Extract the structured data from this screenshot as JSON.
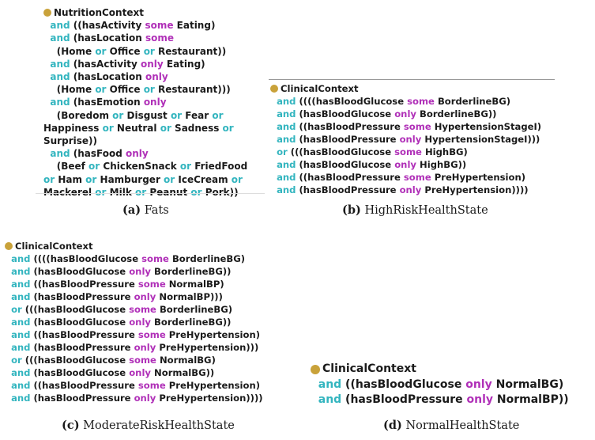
{
  "colors": {
    "keyword_connective": "#33b5bf",
    "keyword_quantifier": "#b030b8",
    "text": "#1a1a1a",
    "class_dot": "#c9a23a"
  },
  "panels": [
    {
      "id": "a",
      "class_name": "NutritionContext",
      "lines": [
        [
          {
            "t": "  "
          },
          {
            "k": "and",
            "c": "kw-and"
          },
          {
            "t": " ((hasActivity "
          },
          {
            "k": "some",
            "c": "kw-some"
          },
          {
            "t": " Eating)"
          }
        ],
        [
          {
            "t": "  "
          },
          {
            "k": "and",
            "c": "kw-and"
          },
          {
            "t": " (hasLocation "
          },
          {
            "k": "some",
            "c": "kw-some"
          }
        ],
        [
          {
            "t": "    (Home "
          },
          {
            "k": "or",
            "c": "kw-or"
          },
          {
            "t": " Office "
          },
          {
            "k": "or",
            "c": "kw-or"
          },
          {
            "t": " Restaurant))"
          }
        ],
        [
          {
            "t": "  "
          },
          {
            "k": "and",
            "c": "kw-and"
          },
          {
            "t": " (hasActivity "
          },
          {
            "k": "only",
            "c": "kw-only"
          },
          {
            "t": " Eating)"
          }
        ],
        [
          {
            "t": "  "
          },
          {
            "k": "and",
            "c": "kw-and"
          },
          {
            "t": " (hasLocation "
          },
          {
            "k": "only",
            "c": "kw-only"
          }
        ],
        [
          {
            "t": "    (Home "
          },
          {
            "k": "or",
            "c": "kw-or"
          },
          {
            "t": " Office "
          },
          {
            "k": "or",
            "c": "kw-or"
          },
          {
            "t": " Restaurant)))"
          }
        ],
        [
          {
            "t": "  "
          },
          {
            "k": "and",
            "c": "kw-and"
          },
          {
            "t": " (hasEmotion "
          },
          {
            "k": "only",
            "c": "kw-only"
          }
        ],
        [
          {
            "t": "    (Boredom "
          },
          {
            "k": "or",
            "c": "kw-or"
          },
          {
            "t": " Disgust "
          },
          {
            "k": "or",
            "c": "kw-or"
          },
          {
            "t": " Fear "
          },
          {
            "k": "or",
            "c": "kw-or"
          }
        ],
        [
          {
            "t": "Happiness "
          },
          {
            "k": "or",
            "c": "kw-or"
          },
          {
            "t": " Neutral "
          },
          {
            "k": "or",
            "c": "kw-or"
          },
          {
            "t": " Sadness "
          },
          {
            "k": "or",
            "c": "kw-or"
          }
        ],
        [
          {
            "t": "Surprise))"
          }
        ],
        [
          {
            "t": "  "
          },
          {
            "k": "and",
            "c": "kw-and"
          },
          {
            "t": " (hasFood "
          },
          {
            "k": "only",
            "c": "kw-only"
          }
        ],
        [
          {
            "t": "    (Beef "
          },
          {
            "k": "or",
            "c": "kw-or"
          },
          {
            "t": " ChickenSnack "
          },
          {
            "k": "or",
            "c": "kw-or"
          },
          {
            "t": " FriedFood"
          }
        ],
        [
          {
            "k": "or",
            "c": "kw-or"
          },
          {
            "t": " Ham "
          },
          {
            "k": "or",
            "c": "kw-or"
          },
          {
            "t": " Hamburger "
          },
          {
            "k": "or",
            "c": "kw-or"
          },
          {
            "t": " IceCream "
          },
          {
            "k": "or",
            "c": "kw-or"
          }
        ],
        [
          {
            "t": "Mackerel "
          },
          {
            "k": "or",
            "c": "kw-or"
          },
          {
            "t": " Milk "
          },
          {
            "k": "or",
            "c": "kw-or"
          },
          {
            "t": " Peanut "
          },
          {
            "k": "or",
            "c": "kw-or"
          },
          {
            "t": " Pork))"
          }
        ]
      ],
      "caption_label": "(a)",
      "caption_text": " Fats"
    },
    {
      "id": "b",
      "class_name": "ClinicalContext",
      "lines": [
        [
          {
            "t": "  "
          },
          {
            "k": "and",
            "c": "kw-and"
          },
          {
            "t": " ((((hasBloodGlucose "
          },
          {
            "k": "some",
            "c": "kw-some"
          },
          {
            "t": " BorderlineBG)"
          }
        ],
        [
          {
            "t": "  "
          },
          {
            "k": "and",
            "c": "kw-and"
          },
          {
            "t": " (hasBloodGlucose "
          },
          {
            "k": "only",
            "c": "kw-only"
          },
          {
            "t": " BorderlineBG))"
          }
        ],
        [
          {
            "t": "  "
          },
          {
            "k": "and",
            "c": "kw-and"
          },
          {
            "t": " ((hasBloodPressure "
          },
          {
            "k": "some",
            "c": "kw-some"
          },
          {
            "t": " HypertensionStageI)"
          }
        ],
        [
          {
            "t": "  "
          },
          {
            "k": "and",
            "c": "kw-and"
          },
          {
            "t": " (hasBloodPressure "
          },
          {
            "k": "only",
            "c": "kw-only"
          },
          {
            "t": " HypertensionStageI)))"
          }
        ],
        [
          {
            "t": "  "
          },
          {
            "k": "or",
            "c": "kw-or"
          },
          {
            "t": " (((hasBloodGlucose "
          },
          {
            "k": "some",
            "c": "kw-some"
          },
          {
            "t": " HighBG)"
          }
        ],
        [
          {
            "t": "  "
          },
          {
            "k": "and",
            "c": "kw-and"
          },
          {
            "t": " (hasBloodGlucose "
          },
          {
            "k": "only",
            "c": "kw-only"
          },
          {
            "t": " HighBG))"
          }
        ],
        [
          {
            "t": "  "
          },
          {
            "k": "and",
            "c": "kw-and"
          },
          {
            "t": " ((hasBloodPressure "
          },
          {
            "k": "some",
            "c": "kw-some"
          },
          {
            "t": " PreHypertension)"
          }
        ],
        [
          {
            "t": "  "
          },
          {
            "k": "and",
            "c": "kw-and"
          },
          {
            "t": " (hasBloodPressure "
          },
          {
            "k": "only",
            "c": "kw-only"
          },
          {
            "t": " PreHypertension))))"
          }
        ]
      ],
      "caption_label": "(b)",
      "caption_text": " HighRiskHealthState"
    },
    {
      "id": "c",
      "class_name": "ClinicalContext",
      "lines": [
        [
          {
            "t": "  "
          },
          {
            "k": "and",
            "c": "kw-and"
          },
          {
            "t": " ((((hasBloodGlucose "
          },
          {
            "k": "some",
            "c": "kw-some"
          },
          {
            "t": " BorderlineBG)"
          }
        ],
        [
          {
            "t": "  "
          },
          {
            "k": "and",
            "c": "kw-and"
          },
          {
            "t": " (hasBloodGlucose "
          },
          {
            "k": "only",
            "c": "kw-only"
          },
          {
            "t": " BorderlineBG))"
          }
        ],
        [
          {
            "t": "  "
          },
          {
            "k": "and",
            "c": "kw-and"
          },
          {
            "t": " ((hasBloodPressure "
          },
          {
            "k": "some",
            "c": "kw-some"
          },
          {
            "t": " NormalBP)"
          }
        ],
        [
          {
            "t": "  "
          },
          {
            "k": "and",
            "c": "kw-and"
          },
          {
            "t": " (hasBloodPressure "
          },
          {
            "k": "only",
            "c": "kw-only"
          },
          {
            "t": " NormalBP)))"
          }
        ],
        [
          {
            "t": "  "
          },
          {
            "k": "or",
            "c": "kw-or"
          },
          {
            "t": " (((hasBloodGlucose "
          },
          {
            "k": "some",
            "c": "kw-some"
          },
          {
            "t": " BorderlineBG)"
          }
        ],
        [
          {
            "t": "  "
          },
          {
            "k": "and",
            "c": "kw-and"
          },
          {
            "t": " (hasBloodGlucose "
          },
          {
            "k": "only",
            "c": "kw-only"
          },
          {
            "t": " BorderlineBG))"
          }
        ],
        [
          {
            "t": "  "
          },
          {
            "k": "and",
            "c": "kw-and"
          },
          {
            "t": " ((hasBloodPressure "
          },
          {
            "k": "some",
            "c": "kw-some"
          },
          {
            "t": " PreHypertension)"
          }
        ],
        [
          {
            "t": "  "
          },
          {
            "k": "and",
            "c": "kw-and"
          },
          {
            "t": " (hasBloodPressure "
          },
          {
            "k": "only",
            "c": "kw-only"
          },
          {
            "t": " PreHypertension)))"
          }
        ],
        [
          {
            "t": "  "
          },
          {
            "k": "or",
            "c": "kw-or"
          },
          {
            "t": " (((hasBloodGlucose "
          },
          {
            "k": "some",
            "c": "kw-some"
          },
          {
            "t": " NormalBG)"
          }
        ],
        [
          {
            "t": "  "
          },
          {
            "k": "and",
            "c": "kw-and"
          },
          {
            "t": " (hasBloodGlucose "
          },
          {
            "k": "only",
            "c": "kw-only"
          },
          {
            "t": " NormalBG))"
          }
        ],
        [
          {
            "t": "  "
          },
          {
            "k": "and",
            "c": "kw-and"
          },
          {
            "t": " ((hasBloodPressure "
          },
          {
            "k": "some",
            "c": "kw-some"
          },
          {
            "t": " PreHypertension)"
          }
        ],
        [
          {
            "t": "  "
          },
          {
            "k": "and",
            "c": "kw-and"
          },
          {
            "t": " (hasBloodPressure "
          },
          {
            "k": "only",
            "c": "kw-only"
          },
          {
            "t": " PreHypertension))))"
          }
        ]
      ],
      "caption_label": "(c)",
      "caption_text": " ModerateRiskHealthState"
    },
    {
      "id": "d",
      "class_name": "ClinicalContext",
      "lines": [
        [
          {
            "t": "  "
          },
          {
            "k": "and",
            "c": "kw-and"
          },
          {
            "t": " ((hasBloodGlucose "
          },
          {
            "k": "only",
            "c": "kw-only"
          },
          {
            "t": " NormalBG)"
          }
        ],
        [
          {
            "t": "  "
          },
          {
            "k": "and",
            "c": "kw-and"
          },
          {
            "t": " (hasBloodPressure "
          },
          {
            "k": "only",
            "c": "kw-only"
          },
          {
            "t": " NormalBP))"
          }
        ]
      ],
      "caption_label": "(d)",
      "caption_text": " NormalHealthState"
    }
  ]
}
